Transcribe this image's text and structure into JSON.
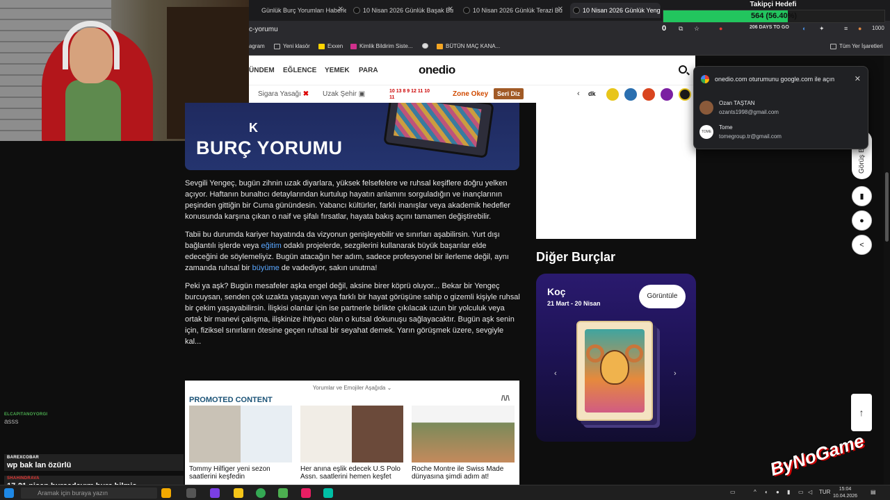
{
  "browser": {
    "tabs": [
      {
        "title": "Günlük Burç Yorumları Haberleri",
        "active": false
      },
      {
        "title": "10 Nisan 2026 Günlük Başak Bu",
        "active": false
      },
      {
        "title": "10 Nisan 2026 Günlük Terazi Bu",
        "active": false
      },
      {
        "title": "10 Nisan 2026 Günlük Yengeç",
        "active": true
      }
    ],
    "address": "c-yorumu",
    "bookmarks": [
      "agram",
      "Yeni klasör",
      "Exxen",
      "Kimlik Bildirim Siste...",
      "BÜTÜN MAÇ KANA..."
    ],
    "bookmarks_right": "Tüm Yer İşaretleri",
    "toolbar_count": "0",
    "days_badge": "206 DAYS TO GO",
    "toolbar_num": "1000"
  },
  "site": {
    "nav": [
      "ÜNDEM",
      "EĞLENCE",
      "YEMEK",
      "PARA"
    ],
    "logo": "onedio",
    "tags": [
      "Sigara Yasağı",
      "Uzak Şehir"
    ],
    "numbers_top": "10 13  8  9  12 11 10",
    "numbers_bottom": "             11",
    "zone": "Zone Okey",
    "seri": "Seri Diz",
    "dk": "dk"
  },
  "hero": {
    "prefix": "K",
    "title": "BURÇ YORUMU"
  },
  "article": {
    "p1": "Sevgili Yengeç, bugün zihnin uzak diyarlara, yüksek felsefelere ve ruhsal keşiflere doğru yelken açıyor. Haftanın bunaltıcı detaylarından kurtulup hayatın anlamını sorguladığın ve inançlarının peşinden gittiğin bir Cuma günündesin. Yabancı kültürler, farklı inanışlar veya akademik hedefler konusunda karşına çıkan o naif ve şifalı fırsatlar, hayata bakış açını tamamen değiştirebilir.",
    "p2a": "Tabii bu durumda kariyer hayatında da vizyonun genişleyebilir ve sınırları aşabilirsin. Yurt dışı bağlantılı işlerde veya ",
    "p2link1": "eğitim",
    "p2b": " odaklı projelerde, sezgilerini kullanarak büyük başarılar elde edeceğini de söylemeliyiz. Bugün atacağın her adım, sadece profesyonel bir ilerleme değil, aynı zamanda ruhsal bir ",
    "p2link2": "büyüme",
    "p2c": " de vadediyor, sakın unutma!",
    "p3": "Peki ya aşk? Bugün mesafeler aşka engel değil, aksine birer köprü oluyor... Bekar bir Yengeç burcuysan, senden çok uzakta yaşayan veya farklı bir hayat görüşüne sahip o gizemli kişiyle ruhsal bir çekim yaşayabilirsin. İlişkisi olanlar için ise partnerle birlikte çıkılacak uzun bir yolculuk veya ortak bir manevi çalışma, ilişkinize ihtiyacı olan o kutsal dokunuşu sağlayacaktır. Bugün aşk senin için, fiziksel sınırların ötesine geçen ruhsal bir seyahat demek. Yarın görüşmek üzere, sevgiyle kal..."
  },
  "promo": {
    "top": "Yorumlar ve Emojiler Aşağıda ⌄",
    "title": "PROMOTED CONTENT",
    "items": [
      {
        "caption": "Tommy Hilfiger yeni sezon saatlerini keşfedin"
      },
      {
        "caption": "Her anına eşlik edecek U.S Polo Assn. saatlerini hemen keşfet"
      },
      {
        "caption": "Roche Montre ile Swiss Made dünyasına şimdi adım at!"
      }
    ]
  },
  "sidebar": {
    "heading": "Diğer Burçlar",
    "zodiac": {
      "name": "Koç",
      "dates": "21 Mart - 20 Nisan",
      "button": "Görüntüle"
    },
    "gorus": "Görüş B"
  },
  "google_popup": {
    "title": "onedio.com oturumunu google.com ile açın",
    "accounts": [
      {
        "name": "Ozan TAŞTAN",
        "email": "ozants1998@gmail.com"
      },
      {
        "name": "Tome",
        "email": "tomegroup.tr@gmail.com"
      }
    ]
  },
  "follower": {
    "title": "Takipçi Hedefi",
    "text": "564 (56.40%)",
    "progress": 0.564
  },
  "chat": [
    {
      "user": "ELCAPITANOYORGI",
      "text": "asss",
      "user_color": "#4caf50"
    },
    {
      "user": "BAREXCOBAR",
      "text": "wp bak lan özürlü",
      "user_color": "#ffffff"
    },
    {
      "user": "SHAHINDRAVA",
      "text": "17-21 nisan bursadayım burç bilmiş",
      "user_color": "#e53935"
    }
  ],
  "taskbar": {
    "search": "Aramak için buraya yazın",
    "lang": "TUR",
    "time": "15:04",
    "date": "10.04.2026"
  },
  "watermark": "ByNoGame"
}
